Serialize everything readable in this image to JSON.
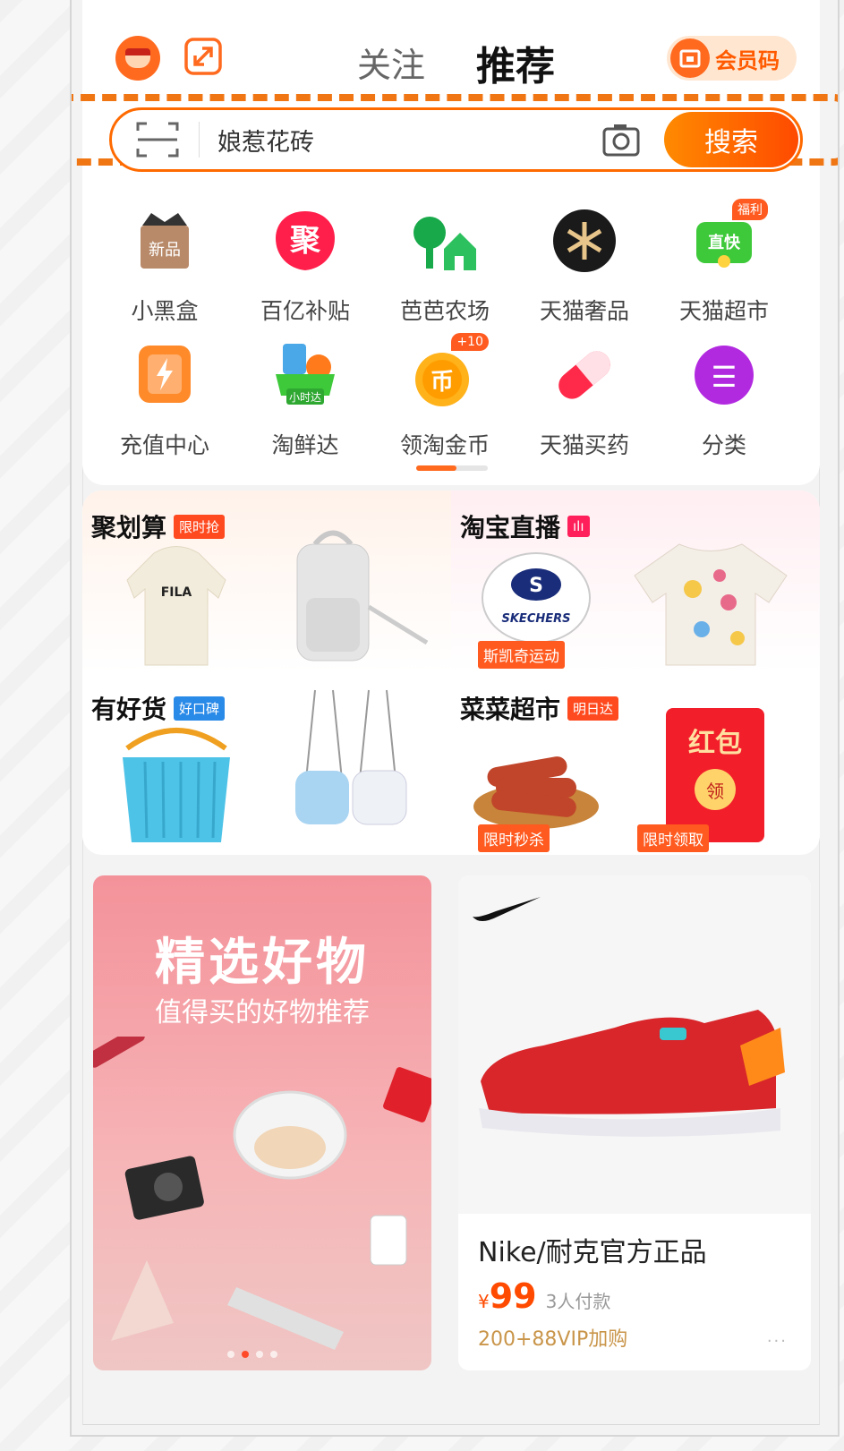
{
  "topbar": {
    "tab_follow": "关注",
    "tab_recommend": "推荐",
    "member_code": "会员码"
  },
  "search": {
    "query": "娘惹花砖",
    "button_label": "搜索"
  },
  "icons_row1": [
    {
      "label": "小黑盒",
      "icon": "black-box-icon",
      "art": "新品"
    },
    {
      "label": "百亿补贴",
      "icon": "subsidy-icon",
      "art": "聚"
    },
    {
      "label": "芭芭农场",
      "icon": "farm-icon"
    },
    {
      "label": "天猫奢品",
      "icon": "luxury-icon"
    },
    {
      "label": "天猫超市",
      "icon": "supermarket-icon",
      "art": "直快",
      "badge": "福利"
    }
  ],
  "icons_row2": [
    {
      "label": "充值中心",
      "icon": "recharge-icon"
    },
    {
      "label": "淘鲜达",
      "icon": "fresh-icon",
      "art": "小时达"
    },
    {
      "label": "领淘金币",
      "icon": "coin-icon",
      "art": "币",
      "badge": "+10"
    },
    {
      "label": "天猫买药",
      "icon": "pill-icon"
    },
    {
      "label": "分类",
      "icon": "category-icon",
      "art": "☰"
    }
  ],
  "promo": {
    "juhuasuan": {
      "title": "聚划算",
      "tag": "限时抢",
      "brand": "FILA"
    },
    "live": {
      "title": "淘宝直播",
      "tag": "ılı",
      "sub": "斯凯奇运动",
      "brand": "SKECHERS"
    },
    "haohuo": {
      "title": "有好货",
      "tag": "好口碑"
    },
    "cainiao": {
      "title": "菜菜超市",
      "tag": "明日达",
      "sub1": "限时秒杀",
      "sub2": "限时领取",
      "hongbao": "红包",
      "ling": "领"
    }
  },
  "feed_left": {
    "title": "精选好物",
    "subtitle": "值得买的好物推荐"
  },
  "feed_right": {
    "product_name": "Nike/耐克官方正品",
    "price_symbol": "¥",
    "price": "99",
    "paid": "3人付款",
    "vip": "200+88VIP加购",
    "more": "···"
  },
  "colors": {
    "accent": "#ff6a00",
    "dashed_highlight": "#f07614",
    "price": "#ff4a00"
  }
}
